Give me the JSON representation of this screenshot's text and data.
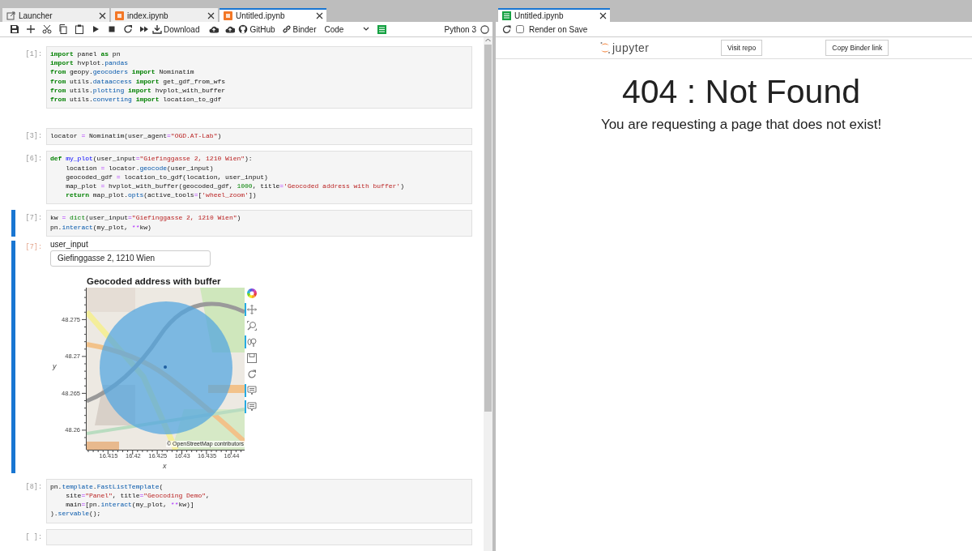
{
  "left_panel": {
    "tabs": [
      {
        "label": "Launcher",
        "selected": false
      },
      {
        "label": "index.ipynb",
        "selected": false
      },
      {
        "label": "Untitled.ipynb",
        "selected": true
      }
    ],
    "toolbar": {
      "buttons": [
        "Download",
        "GitHub",
        "Binder"
      ],
      "cell_type": "Code",
      "kernel": "Python 3"
    },
    "cells": [
      {
        "prompt": "[1]:",
        "selected": false,
        "lines": [
          [
            {
              "text": "import",
              "kind": "kw"
            },
            {
              "text": " panel "
            },
            {
              "text": "as",
              "kind": "kw"
            },
            {
              "text": " pn"
            }
          ],
          [
            {
              "text": "import",
              "kind": "kw"
            },
            {
              "text": " hvplot."
            },
            {
              "text": "pandas",
              "kind": "mod"
            }
          ],
          [
            {
              "text": "from",
              "kind": "kw"
            },
            {
              "text": " geopy."
            },
            {
              "text": "geocoders ",
              "kind": "mod"
            },
            {
              "text": "import",
              "kind": "kw"
            },
            {
              "text": " Nominatim"
            }
          ],
          [
            {
              "text": "from",
              "kind": "kw"
            },
            {
              "text": " utils."
            },
            {
              "text": "dataaccess ",
              "kind": "mod"
            },
            {
              "text": "import",
              "kind": "kw"
            },
            {
              "text": " get_gdf_from_wfs"
            }
          ],
          [
            {
              "text": "from",
              "kind": "kw"
            },
            {
              "text": " utils."
            },
            {
              "text": "plotting ",
              "kind": "mod"
            },
            {
              "text": "import",
              "kind": "kw"
            },
            {
              "text": " hvplot_with_buffer"
            }
          ],
          [
            {
              "text": "from",
              "kind": "kw"
            },
            {
              "text": " utils."
            },
            {
              "text": "converting ",
              "kind": "mod"
            },
            {
              "text": "import",
              "kind": "kw"
            },
            {
              "text": " location_to_gdf"
            }
          ]
        ]
      },
      {
        "prompt": "[3]:",
        "selected": false,
        "lines": [
          [
            {
              "text": "locator "
            },
            {
              "text": "=",
              "kind": "op"
            },
            {
              "text": " Nominatim(user_agent"
            },
            {
              "text": "=",
              "kind": "op"
            },
            {
              "text": "\"OGD.AT-Lab\"",
              "kind": "str"
            },
            {
              "text": ")"
            }
          ]
        ]
      },
      {
        "prompt": "[6]:",
        "selected": false,
        "lines": [
          [
            {
              "text": "def",
              "kind": "kw"
            },
            {
              "text": " my_plot",
              "kind": "fn"
            },
            {
              "text": "(user_input"
            },
            {
              "text": "=",
              "kind": "op"
            },
            {
              "text": "\"Giefinggasse 2, 1210 Wien\"",
              "kind": "str"
            },
            {
              "text": "):"
            }
          ],
          [
            {
              "text": "    location "
            },
            {
              "text": "=",
              "kind": "op"
            },
            {
              "text": " locator."
            },
            {
              "text": "geocode",
              "kind": "mod"
            },
            {
              "text": "(user_input)"
            }
          ],
          [
            {
              "text": "    geocoded_gdf "
            },
            {
              "text": "=",
              "kind": "op"
            },
            {
              "text": " location_to_gdf(location, user_input)"
            }
          ],
          [
            {
              "text": "    map_plot "
            },
            {
              "text": "=",
              "kind": "op"
            },
            {
              "text": " hvplot_with_buffer(geocoded_gdf, "
            },
            {
              "text": "1000",
              "kind": "num"
            },
            {
              "text": ", title"
            },
            {
              "text": "=",
              "kind": "op"
            },
            {
              "text": "'Geocoded address with buffer'",
              "kind": "str"
            },
            {
              "text": ")"
            }
          ],
          [
            {
              "text": "    return",
              "kind": "kw"
            },
            {
              "text": " map_plot."
            },
            {
              "text": "opts",
              "kind": "mod"
            },
            {
              "text": "(active_tools"
            },
            {
              "text": "=",
              "kind": "op"
            },
            {
              "text": "["
            },
            {
              "text": "'wheel_zoom'",
              "kind": "str"
            },
            {
              "text": "])"
            }
          ]
        ]
      },
      {
        "prompt": "[7]:",
        "selected": true,
        "lines": [
          [
            {
              "text": "kw "
            },
            {
              "text": "=",
              "kind": "op"
            },
            {
              "text": " dict",
              "kind": "builtin"
            },
            {
              "text": "(user_input"
            },
            {
              "text": "=",
              "kind": "op"
            },
            {
              "text": "\"Giefinggasse 2, 1210 Wien\"",
              "kind": "str"
            },
            {
              "text": ")"
            }
          ],
          [
            {
              "text": "pn."
            },
            {
              "text": "interact",
              "kind": "mod"
            },
            {
              "text": "(my_plot, "
            },
            {
              "text": "**",
              "kind": "op"
            },
            {
              "text": "kw)"
            }
          ]
        ],
        "output": {
          "prompt": "[7]:",
          "widget_label": "user_input",
          "value": "Giefinggasse 2, 1210 Wien",
          "plot": {
            "title": "Geocoded address with buffer",
            "ylabel": "y",
            "xlabel": "x",
            "yticks": [
              "48.275",
              "48.27",
              "48.265",
              "48.26"
            ],
            "xticks": [
              "16.415",
              "16.42",
              "16.425",
              "16.43",
              "16.435",
              "16.44"
            ],
            "attribution": "© OpenStreetMap contributors",
            "tools": [
              {
                "active": true
              },
              {
                "active": false
              },
              {
                "active": true
              },
              {
                "active": false
              },
              {
                "active": false
              },
              {
                "active": true
              },
              {
                "active": true
              }
            ]
          }
        }
      },
      {
        "prompt": "[8]:",
        "selected": false,
        "lines": [
          [
            {
              "text": "pn."
            },
            {
              "text": "template",
              "kind": "mod"
            },
            {
              "text": "."
            },
            {
              "text": "FastListTemplate",
              "kind": "mod"
            },
            {
              "text": "("
            }
          ],
          [
            {
              "text": "    site"
            },
            {
              "text": "=",
              "kind": "op"
            },
            {
              "text": "\"Panel\"",
              "kind": "str"
            },
            {
              "text": ", title"
            },
            {
              "text": "=",
              "kind": "op"
            },
            {
              "text": "\"Geocoding Demo\"",
              "kind": "str"
            },
            {
              "text": ","
            }
          ],
          [
            {
              "text": "    main"
            },
            {
              "text": "=",
              "kind": "op"
            },
            {
              "text": "[pn."
            },
            {
              "text": "interact",
              "kind": "mod"
            },
            {
              "text": "(my_plot, "
            },
            {
              "text": "**",
              "kind": "op"
            },
            {
              "text": "kw)]"
            }
          ],
          [
            {
              "text": ")."
            },
            {
              "text": "servable",
              "kind": "mod"
            },
            {
              "text": "();"
            }
          ]
        ]
      },
      {
        "prompt": "[ ]:",
        "selected": false
      }
    ]
  },
  "right_panel": {
    "tab": {
      "label": "Untitled.ipynb",
      "selected": true
    },
    "render_on_save": {
      "label": "Render on Save",
      "checked": false
    },
    "header": {
      "logo_text": "jupyter",
      "buttons": [
        "Visit repo",
        "Copy Binder link"
      ]
    },
    "heading": "404 : Not Found",
    "message": "You are requesting a page that does not exist!"
  }
}
